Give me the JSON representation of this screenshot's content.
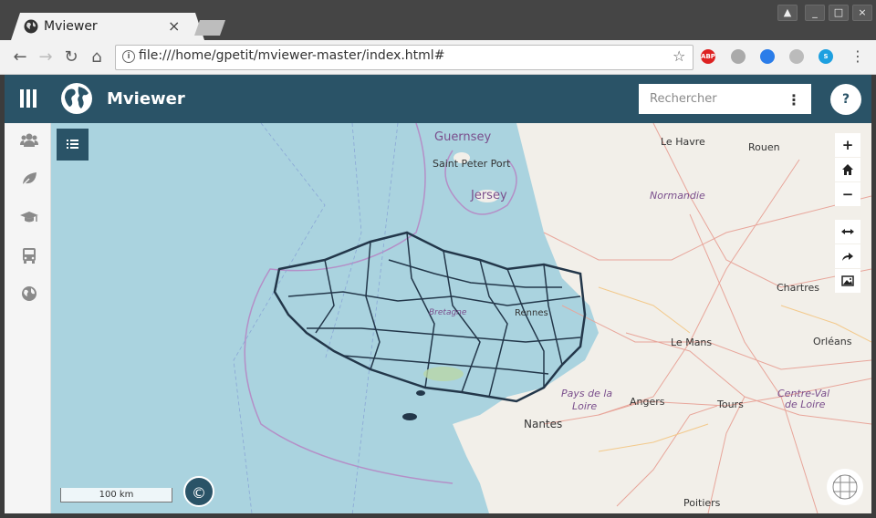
{
  "browser": {
    "tab_title": "Mviewer",
    "url": "file:///home/gpetit/mviewer-master/index.html#",
    "extensions": [
      "ABP"
    ]
  },
  "app": {
    "title": "Mviewer",
    "search_placeholder": "Rechercher",
    "help_label": "?",
    "accent_color": "#2a5367"
  },
  "sidebar": {
    "items": [
      {
        "icon": "users-icon"
      },
      {
        "icon": "leaf-icon"
      },
      {
        "icon": "graduation-cap-icon"
      },
      {
        "icon": "bus-icon"
      },
      {
        "icon": "globe-icon"
      }
    ]
  },
  "map": {
    "scale_label": "100 km",
    "attribution_label": "©",
    "labels": {
      "guernsey": "Guernsey",
      "saint_peter_port": "Saint Peter Port",
      "jersey": "Jersey",
      "le_havre": "Le Havre",
      "rouen": "Rouen",
      "normandie": "Normandie",
      "chartres": "Chartres",
      "le_mans": "Le Mans",
      "orleans": "Orléans",
      "bretagne": "Bretagne",
      "rennes": "Rennes",
      "pays_de_la_loire_1": "Pays de la",
      "pays_de_la_loire_2": "Loire",
      "angers": "Angers",
      "tours": "Tours",
      "centre_val_1": "Centre-Val",
      "centre_val_2": "de Loire",
      "nantes": "Nantes",
      "poitiers": "Poitiers"
    },
    "controls": {
      "zoom_in": "+",
      "zoom_out": "−"
    }
  }
}
